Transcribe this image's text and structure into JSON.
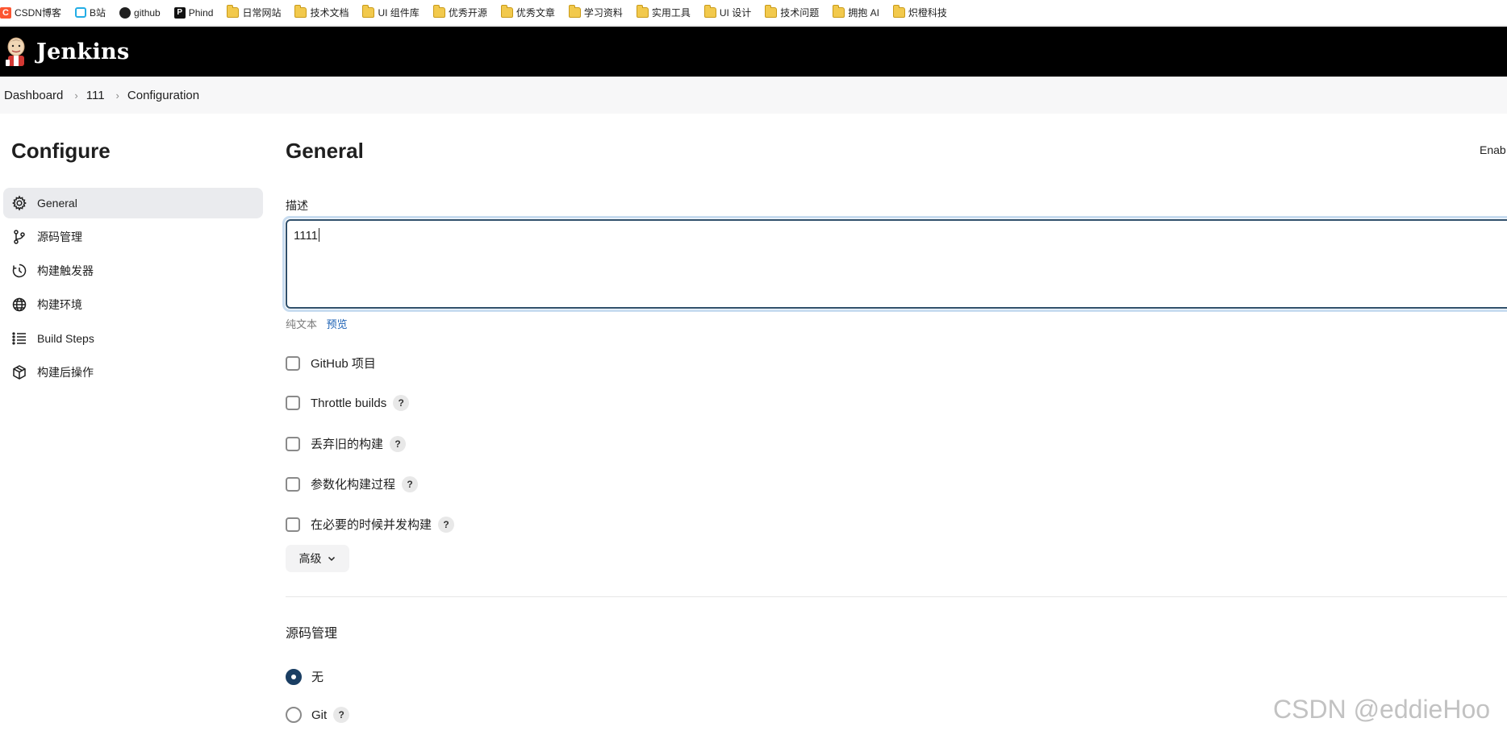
{
  "bookmarks": [
    {
      "label": "CSDN博客",
      "icon": "csdn-icon"
    },
    {
      "label": "B站",
      "icon": "bilibili-icon"
    },
    {
      "label": "github",
      "icon": "github-icon"
    },
    {
      "label": "Phind",
      "icon": "phind-icon"
    },
    {
      "label": "日常网站",
      "icon": "folder-icon"
    },
    {
      "label": "技术文档",
      "icon": "folder-icon"
    },
    {
      "label": "UI 组件库",
      "icon": "folder-icon"
    },
    {
      "label": "优秀开源",
      "icon": "folder-icon"
    },
    {
      "label": "优秀文章",
      "icon": "folder-icon"
    },
    {
      "label": "学习资料",
      "icon": "folder-icon"
    },
    {
      "label": "实用工具",
      "icon": "folder-icon"
    },
    {
      "label": "UI 设计",
      "icon": "folder-icon"
    },
    {
      "label": "技术问题",
      "icon": "folder-icon"
    },
    {
      "label": "拥抱 AI",
      "icon": "folder-icon"
    },
    {
      "label": "炽橙科技",
      "icon": "folder-icon"
    }
  ],
  "header": {
    "brand": "Jenkins"
  },
  "breadcrumb": {
    "items": [
      "Dashboard",
      "111",
      "Configuration"
    ]
  },
  "sidebar": {
    "title": "Configure",
    "items": [
      {
        "label": "General",
        "icon": "gear-icon",
        "active": true
      },
      {
        "label": "源码管理",
        "icon": "branch-icon"
      },
      {
        "label": "构建触发器",
        "icon": "clock-icon"
      },
      {
        "label": "构建环境",
        "icon": "globe-icon"
      },
      {
        "label": "Build Steps",
        "icon": "list-icon"
      },
      {
        "label": "构建后操作",
        "icon": "package-icon"
      }
    ]
  },
  "general": {
    "title": "General",
    "enable_text": "Enab",
    "description_label": "描述",
    "description_value": "1111",
    "plain_text_label": "纯文本",
    "preview_label": "预览",
    "options": [
      {
        "label": "GitHub 项目",
        "help": false,
        "checked": false
      },
      {
        "label": "Throttle builds",
        "help": true,
        "checked": false
      },
      {
        "label": "丢弃旧的构建",
        "help": true,
        "checked": false
      },
      {
        "label": "参数化构建过程",
        "help": true,
        "checked": false
      },
      {
        "label": "在必要的时候并发构建",
        "help": true,
        "checked": false
      }
    ],
    "help_glyph": "?",
    "advanced_label": "高级"
  },
  "scm": {
    "title": "源码管理",
    "options": [
      {
        "label": "无",
        "selected": true,
        "help": false
      },
      {
        "label": "Git",
        "selected": false,
        "help": true
      }
    ]
  },
  "watermark": "CSDN @eddieHoo"
}
